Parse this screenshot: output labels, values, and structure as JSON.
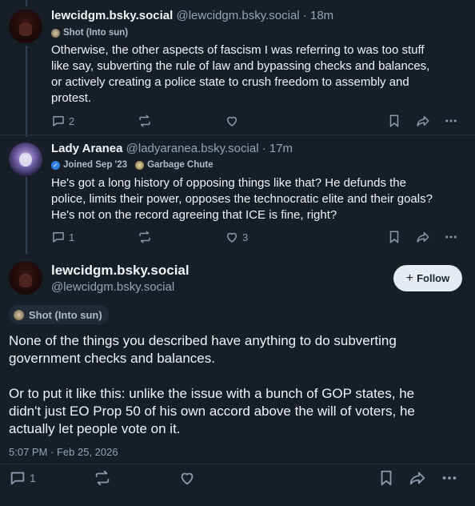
{
  "posts": [
    {
      "display_name": "lewcidgm.bsky.social",
      "handle": "@lewcidgm.bsky.social",
      "time": " · 18m",
      "badges": [
        {
          "icon": "shot-badge-icon",
          "label": "Shot (Into sun)"
        }
      ],
      "lines": [
        "Otherwise, the other aspects of fascism I was referring to was too stuff",
        "like say, subverting the rule of law and bypassing checks and balances,",
        "or actively creating a police state to crush freedom to assembly and",
        "protest."
      ],
      "reply_count": "2",
      "repost_count": "",
      "like_count": ""
    },
    {
      "display_name": "Lady Aranea",
      "handle": "@ladyaranea.bsky.social",
      "time": " · 17m",
      "badges": [
        {
          "icon": "verified-check-icon",
          "label": "Joined Sep '23"
        },
        {
          "icon": "garbage-chute-badge-icon",
          "label": "Garbage Chute"
        }
      ],
      "lines": [
        "He's got a long history of opposing things like that? He defunds the",
        "police, limits their power, opposes the technocratic elite and their goals?",
        "He's not on the record agreeing that ICE is fine, right?"
      ],
      "reply_count": "1",
      "repost_count": "",
      "like_count": "3"
    }
  ],
  "main_post": {
    "display_name": "lewcidgm.bsky.social",
    "handle": "@lewcidgm.bsky.social",
    "follow_label": "Follow",
    "badge": {
      "icon": "shot-badge-icon",
      "label": "Shot (Into sun)"
    },
    "paragraph1": [
      "None of the things you described have anything to do subverting",
      "government checks and balances."
    ],
    "paragraph2": [
      "Or to put it like this: unlike the issue with a bunch of GOP states, he",
      "didn't just EO Prop 50 of his own accord above the will of voters, he",
      "actually let people vote on it."
    ],
    "timestamp": "5:07 PM · Feb 25, 2026",
    "reply_count": "1"
  },
  "colors": {
    "background": "#161e27",
    "text": "#f1f3f5",
    "muted": "#93a5b7",
    "follow_bg": "#e6ebf1"
  }
}
